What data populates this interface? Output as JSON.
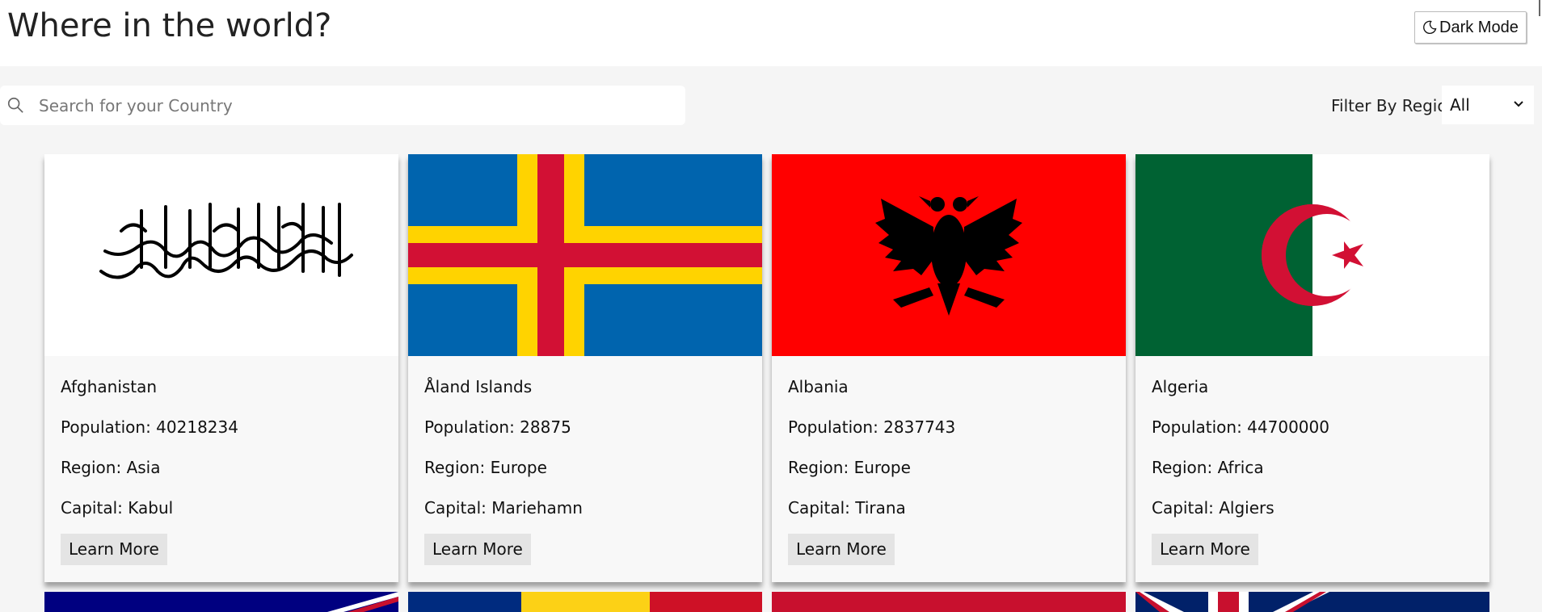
{
  "header": {
    "title": "Where in the world?",
    "dark_mode_label": "Dark Mode"
  },
  "search": {
    "placeholder": "Search for your Country",
    "value": ""
  },
  "filter": {
    "label": "Filter By Region",
    "selected": "All"
  },
  "countries": [
    {
      "name": "Afghanistan",
      "population": "Population: 40218234",
      "region": "Region: Asia",
      "capital": "Capital: Kabul",
      "learn_more": "Learn More"
    },
    {
      "name": "Åland Islands",
      "population": "Population: 28875",
      "region": "Region: Europe",
      "capital": "Capital: Mariehamn",
      "learn_more": "Learn More"
    },
    {
      "name": "Albania",
      "population": "Population: 2837743",
      "region": "Region: Europe",
      "capital": "Capital: Tirana",
      "learn_more": "Learn More"
    },
    {
      "name": "Algeria",
      "population": "Population: 44700000",
      "region": "Region: Africa",
      "capital": "Capital: Algiers",
      "learn_more": "Learn More"
    }
  ],
  "colors": {
    "page_bg": "#f5f5f5",
    "card_bg": "#f8f8f8",
    "button_bg": "#e4e4e4"
  }
}
